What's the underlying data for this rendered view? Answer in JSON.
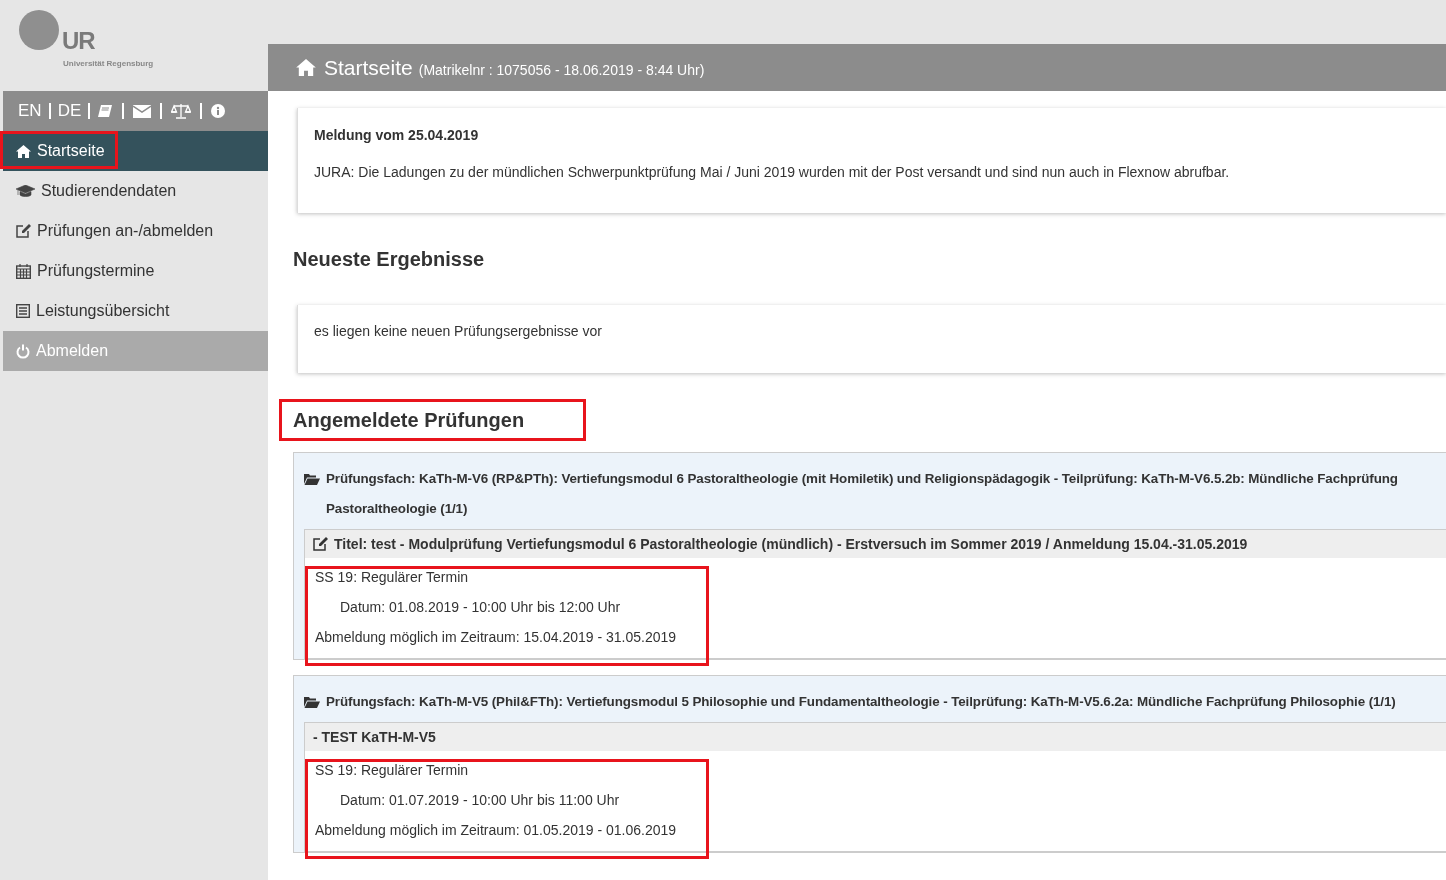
{
  "logo": {
    "mark": "UR",
    "name": "Universität Regensburg"
  },
  "language_bar": {
    "languages": [
      {
        "label": "EN",
        "selected": false
      },
      {
        "label": "DE",
        "selected": false
      }
    ],
    "icons": [
      {
        "kind": "book"
      },
      {
        "kind": "mail"
      },
      {
        "kind": "scale"
      },
      {
        "kind": "info"
      }
    ]
  },
  "nav": {
    "items": [
      {
        "label": "Startseite",
        "kind": "link",
        "selected": true,
        "highlighted": true
      },
      {
        "label": "Studierendendaten",
        "kind": "link",
        "selected": false,
        "highlighted": false
      },
      {
        "label": "Prüfungen an-/abmelden",
        "kind": "link",
        "selected": false,
        "highlighted": false
      },
      {
        "label": "Prüfungstermine",
        "kind": "link",
        "selected": false,
        "highlighted": false
      },
      {
        "label": "Leistungsübersicht",
        "kind": "link",
        "selected": false,
        "highlighted": false
      },
      {
        "label": "Abmelden",
        "kind": "logout",
        "selected": false,
        "highlighted": false
      }
    ]
  },
  "header": {
    "title": "Startseite",
    "subtitle": "(Matrikelnr : 1075056 - 18.06.2019 - 8:44 Uhr)"
  },
  "notice": {
    "title": "Meldung vom 25.04.2019",
    "text": "JURA: Die Ladungen zu der mündlichen Schwerpunktprüfung Mai / Juni 2019 wurden mit der Post versandt und sind nun auch in Flexnow abrufbar."
  },
  "latest_results": {
    "heading": "Neueste Ergebnisse",
    "text": "es liegen keine neuen Prüfungsergebnisse vor"
  },
  "registered_exams": {
    "heading": "Angemeldete Prüfungen",
    "highlighted": true,
    "subjects": [
      {
        "title": "Prüfungsfach: KaTh-M-V6 (RP&PTh): Vertiefungsmodul 6 Pastoraltheologie (mit Homiletik) und Religionspädagogik - Teilprüfung: KaTh-M-V6.5.2b: Mündliche Fachprüfung Pastoraltheologie (1/1)",
        "exam_title": "Titel: test - Modulprüfung Vertiefungsmodul 6 Pastoraltheologie (mündlich) - Erstversuch im Sommer 2019 / Anmeldung 15.04.-31.05.2019",
        "exam_title_icon": true,
        "term": {
          "name": "SS 19: Regulärer Termin",
          "date": "Datum: 01.08.2019 - 10:00 Uhr bis 12:00 Uhr",
          "period": "Abmeldung möglich im Zeitraum: 15.04.2019 - 31.05.2019",
          "highlighted": true
        }
      },
      {
        "title": "Prüfungsfach: KaTh-M-V5 (Phil&FTh): Vertiefungsmodul 5 Philosophie und Fundamentaltheologie - Teilprüfung: KaTh-M-V5.6.2a: Mündliche Fachprüfung Philosophie (1/1)",
        "exam_title": "- TEST KaTH-M-V5",
        "exam_title_icon": false,
        "term": {
          "name": "SS 19: Regulärer Termin",
          "date": "Datum: 01.07.2019 - 10:00 Uhr bis 11:00 Uhr",
          "period": "Abmeldung möglich im Zeitraum: 01.05.2019 - 01.06.2019",
          "highlighted": true
        }
      }
    ]
  }
}
